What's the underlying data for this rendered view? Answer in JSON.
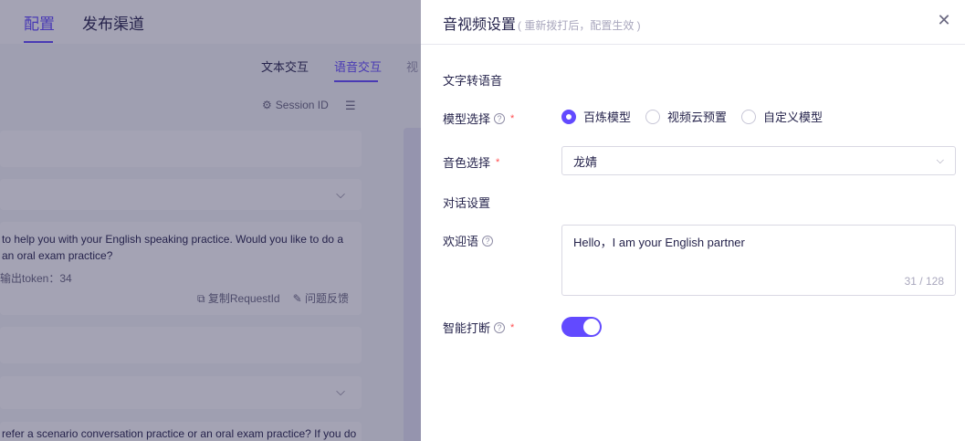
{
  "app": {
    "topnav": {
      "tabs": [
        "配置",
        "发布渠道"
      ]
    },
    "subtabs": [
      "文本交互",
      "语音交互",
      "视"
    ],
    "session_label": "Session ID",
    "cards": {
      "message1": "to help you with your English speaking practice. Would you like to do a an oral exam practice?",
      "tokens": "输出token：34",
      "copy_request": "复制RequestId",
      "feedback": "问题反馈",
      "message2": "refer a scenario conversation practice or an oral exam practice? If you do"
    }
  },
  "drawer": {
    "title": "音视频设置",
    "subtitle": "( 重新拨打后，配置生效 )",
    "tts_section": "文字转语音",
    "model_label": "模型选择",
    "model_options": [
      "百炼模型",
      "视频云预置",
      "自定义模型"
    ],
    "model_selected": "百炼模型",
    "voice_label": "音色选择",
    "voice_value": "龙婧",
    "dialog_section": "对话设置",
    "welcome_label": "欢迎语",
    "welcome_text": "Hello，I am your English partner",
    "welcome_counter": "31 / 128",
    "interrupt_label": "智能打断",
    "interrupt_on": true
  },
  "colors": {
    "accent": "#624aff",
    "required": "#ff4d4f"
  },
  "icons": {
    "close": "close-icon",
    "help": "help-icon",
    "chevron": "chevron-down-icon"
  }
}
